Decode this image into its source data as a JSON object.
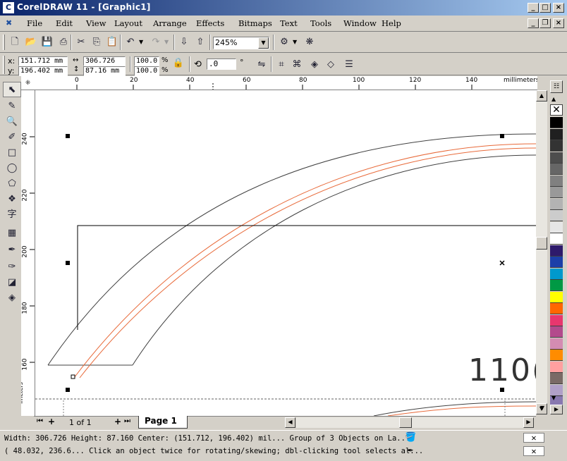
{
  "window": {
    "title": "CorelDRAW 11 - [Graphic1]",
    "logo": "C"
  },
  "menu": {
    "items": [
      "File",
      "Edit",
      "View",
      "Layout",
      "Arrange",
      "Effects",
      "Bitmaps",
      "Text",
      "Tools",
      "Window",
      "Help"
    ]
  },
  "toolbar": {
    "zoom": "245%"
  },
  "propbar": {
    "x_label": "x:",
    "y_label": "y:",
    "x_value": "151.712 mm",
    "y_value": "196.402 mm",
    "w_value": "306.726 m",
    "h_value": "87.16 mm",
    "scale_x": "100.0",
    "scale_y": "100.0",
    "pct": "%",
    "angle": ".0",
    "deg": "°"
  },
  "ruler": {
    "unit": "millimeters",
    "top_ticks": [
      "20",
      "0",
      "20",
      "40",
      "60",
      "80",
      "100",
      "120",
      "140"
    ],
    "left_ticks": [
      "240",
      "220",
      "200",
      "180",
      "160"
    ]
  },
  "canvas": {
    "text_fragment": "110("
  },
  "pagebar": {
    "page_count": "1 of 1",
    "page_tab": "Page 1"
  },
  "status": {
    "line1": "Width: 306.726  Height: 87.160  Center: (151.712, 196.402)  mil...  Group of 3 Objects on La...",
    "line2": "( 48.032, 236.6...  Click an object twice for rotating/skewing; dbl-clicking tool selects al..."
  },
  "colors": {
    "orange": "#e86a3a",
    "dark": "#404040",
    "title_start": "#0a246a",
    "title_end": "#a6caf0"
  },
  "palette": [
    "#000000",
    "#202020",
    "#333333",
    "#4d4d4d",
    "#666666",
    "#808080",
    "#999999",
    "#b3b3b3",
    "#cccccc",
    "#e6e6e6",
    "#ffffff",
    "#2e1a6b",
    "#1c3fa8",
    "#0099cc",
    "#009944",
    "#ffff00",
    "#ff6600",
    "#e8366e",
    "#b34a8c",
    "#d48cb2",
    "#ff8c00",
    "#ffa0a0",
    "#7a6a66",
    "#b0a0c8",
    "#8878b0"
  ]
}
